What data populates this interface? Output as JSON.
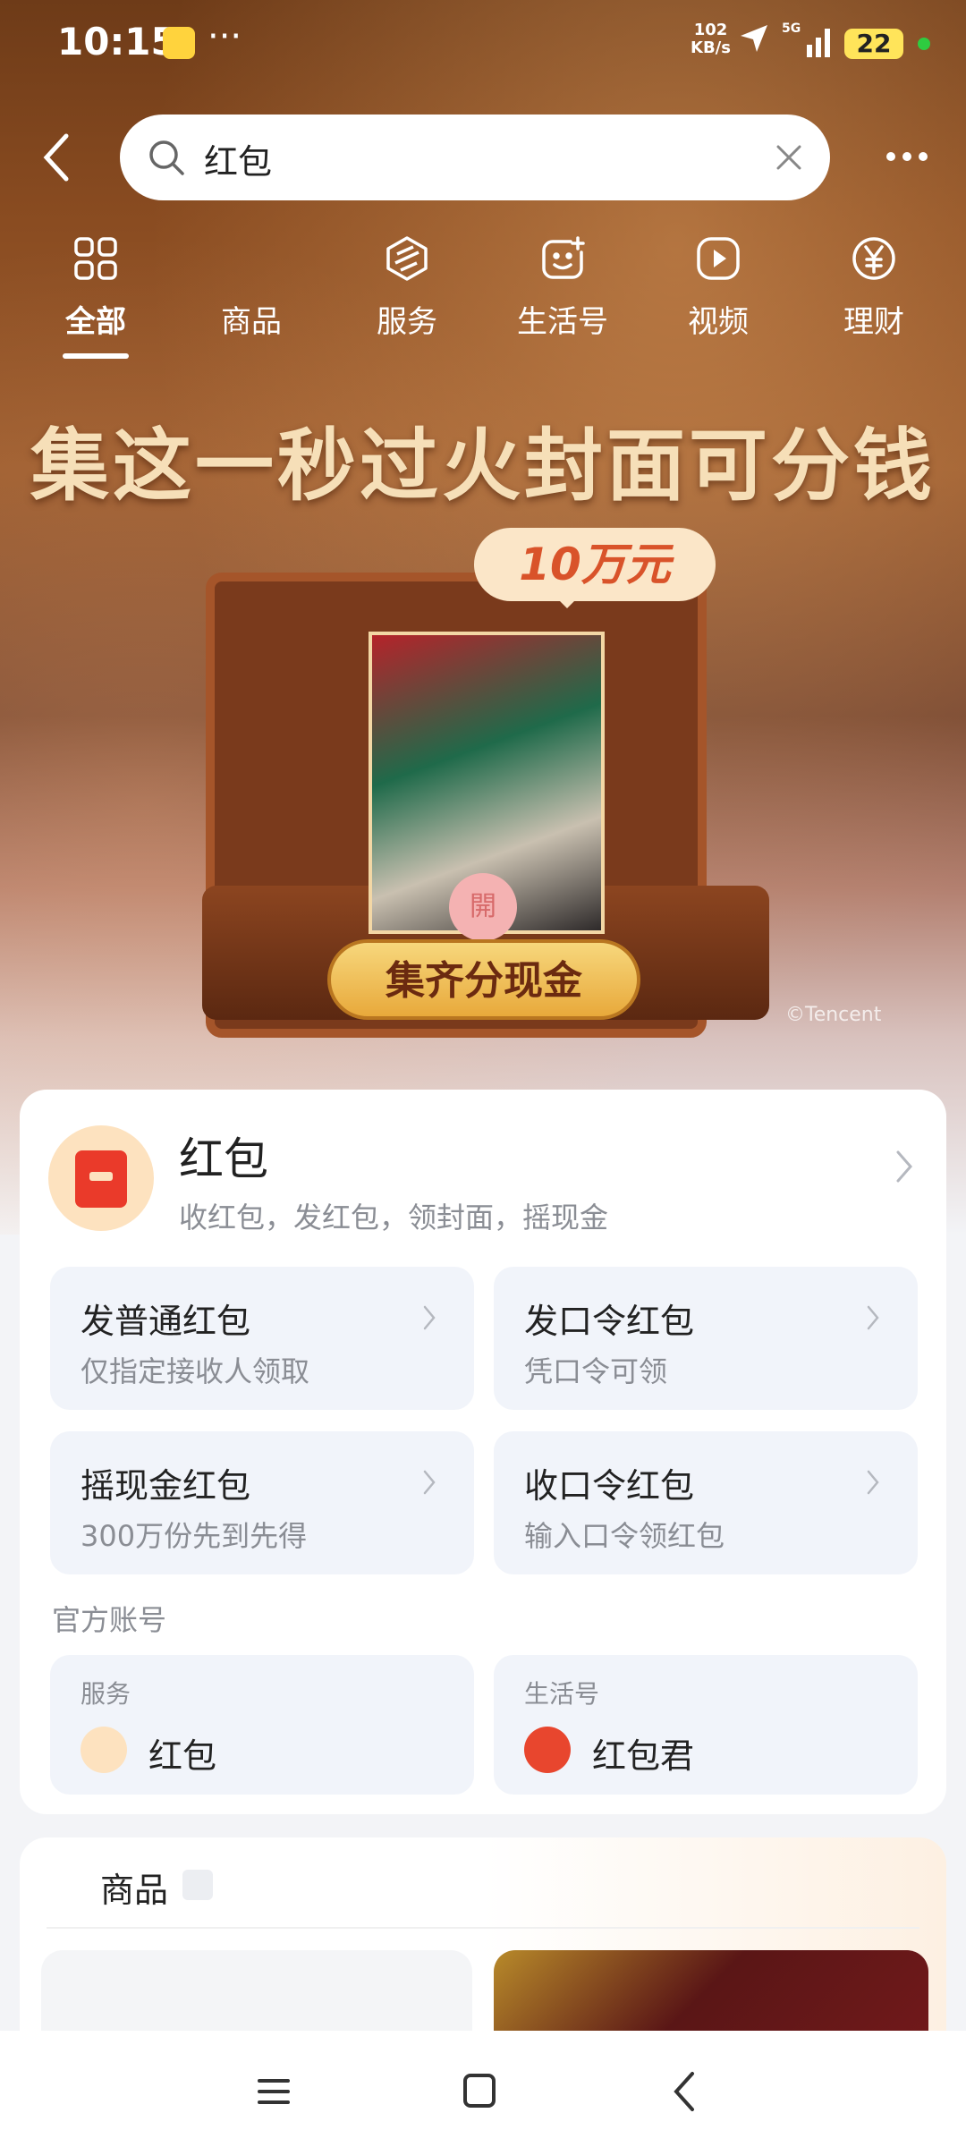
{
  "status_bar": {
    "time": "10:15",
    "dots": "···",
    "speed_value": "102",
    "speed_unit": "KB/s",
    "network": "5G",
    "battery": "22"
  },
  "search": {
    "value": "红包"
  },
  "tabs": [
    {
      "label": "全部",
      "icon": "grid-icon",
      "active": true
    },
    {
      "label": "商品",
      "icon": "goods-icon"
    },
    {
      "label": "服务",
      "icon": "service-icon"
    },
    {
      "label": "生活号",
      "icon": "life-account-icon"
    },
    {
      "label": "视频",
      "icon": "video-icon"
    },
    {
      "label": "理财",
      "icon": "yuan-icon"
    }
  ],
  "banner": {
    "title": "集这一秒过火封面可分钱",
    "prize": "10万元",
    "badge": "開",
    "button": "集齐分现金",
    "credit": "©Tencent"
  },
  "redpacket": {
    "title": "红包",
    "subtitle": "收红包，发红包，领封面，摇现金",
    "actions": [
      {
        "title": "发普通红包",
        "subtitle": "仅指定接收人领取"
      },
      {
        "title": "发口令红包",
        "subtitle": "凭口令可领"
      },
      {
        "title": "摇现金红包",
        "subtitle": "300万份先到先得"
      },
      {
        "title": "收口令红包",
        "subtitle": "输入口令领红包"
      }
    ],
    "official_label": "官方账号",
    "accounts": [
      {
        "kind": "服务",
        "name": "红包"
      },
      {
        "kind": "生活号",
        "name": "红包君"
      }
    ]
  },
  "products": {
    "title": "商品"
  },
  "colors": {
    "accent_red": "#ea3a2a",
    "card_bg": "#f1f4fa"
  }
}
